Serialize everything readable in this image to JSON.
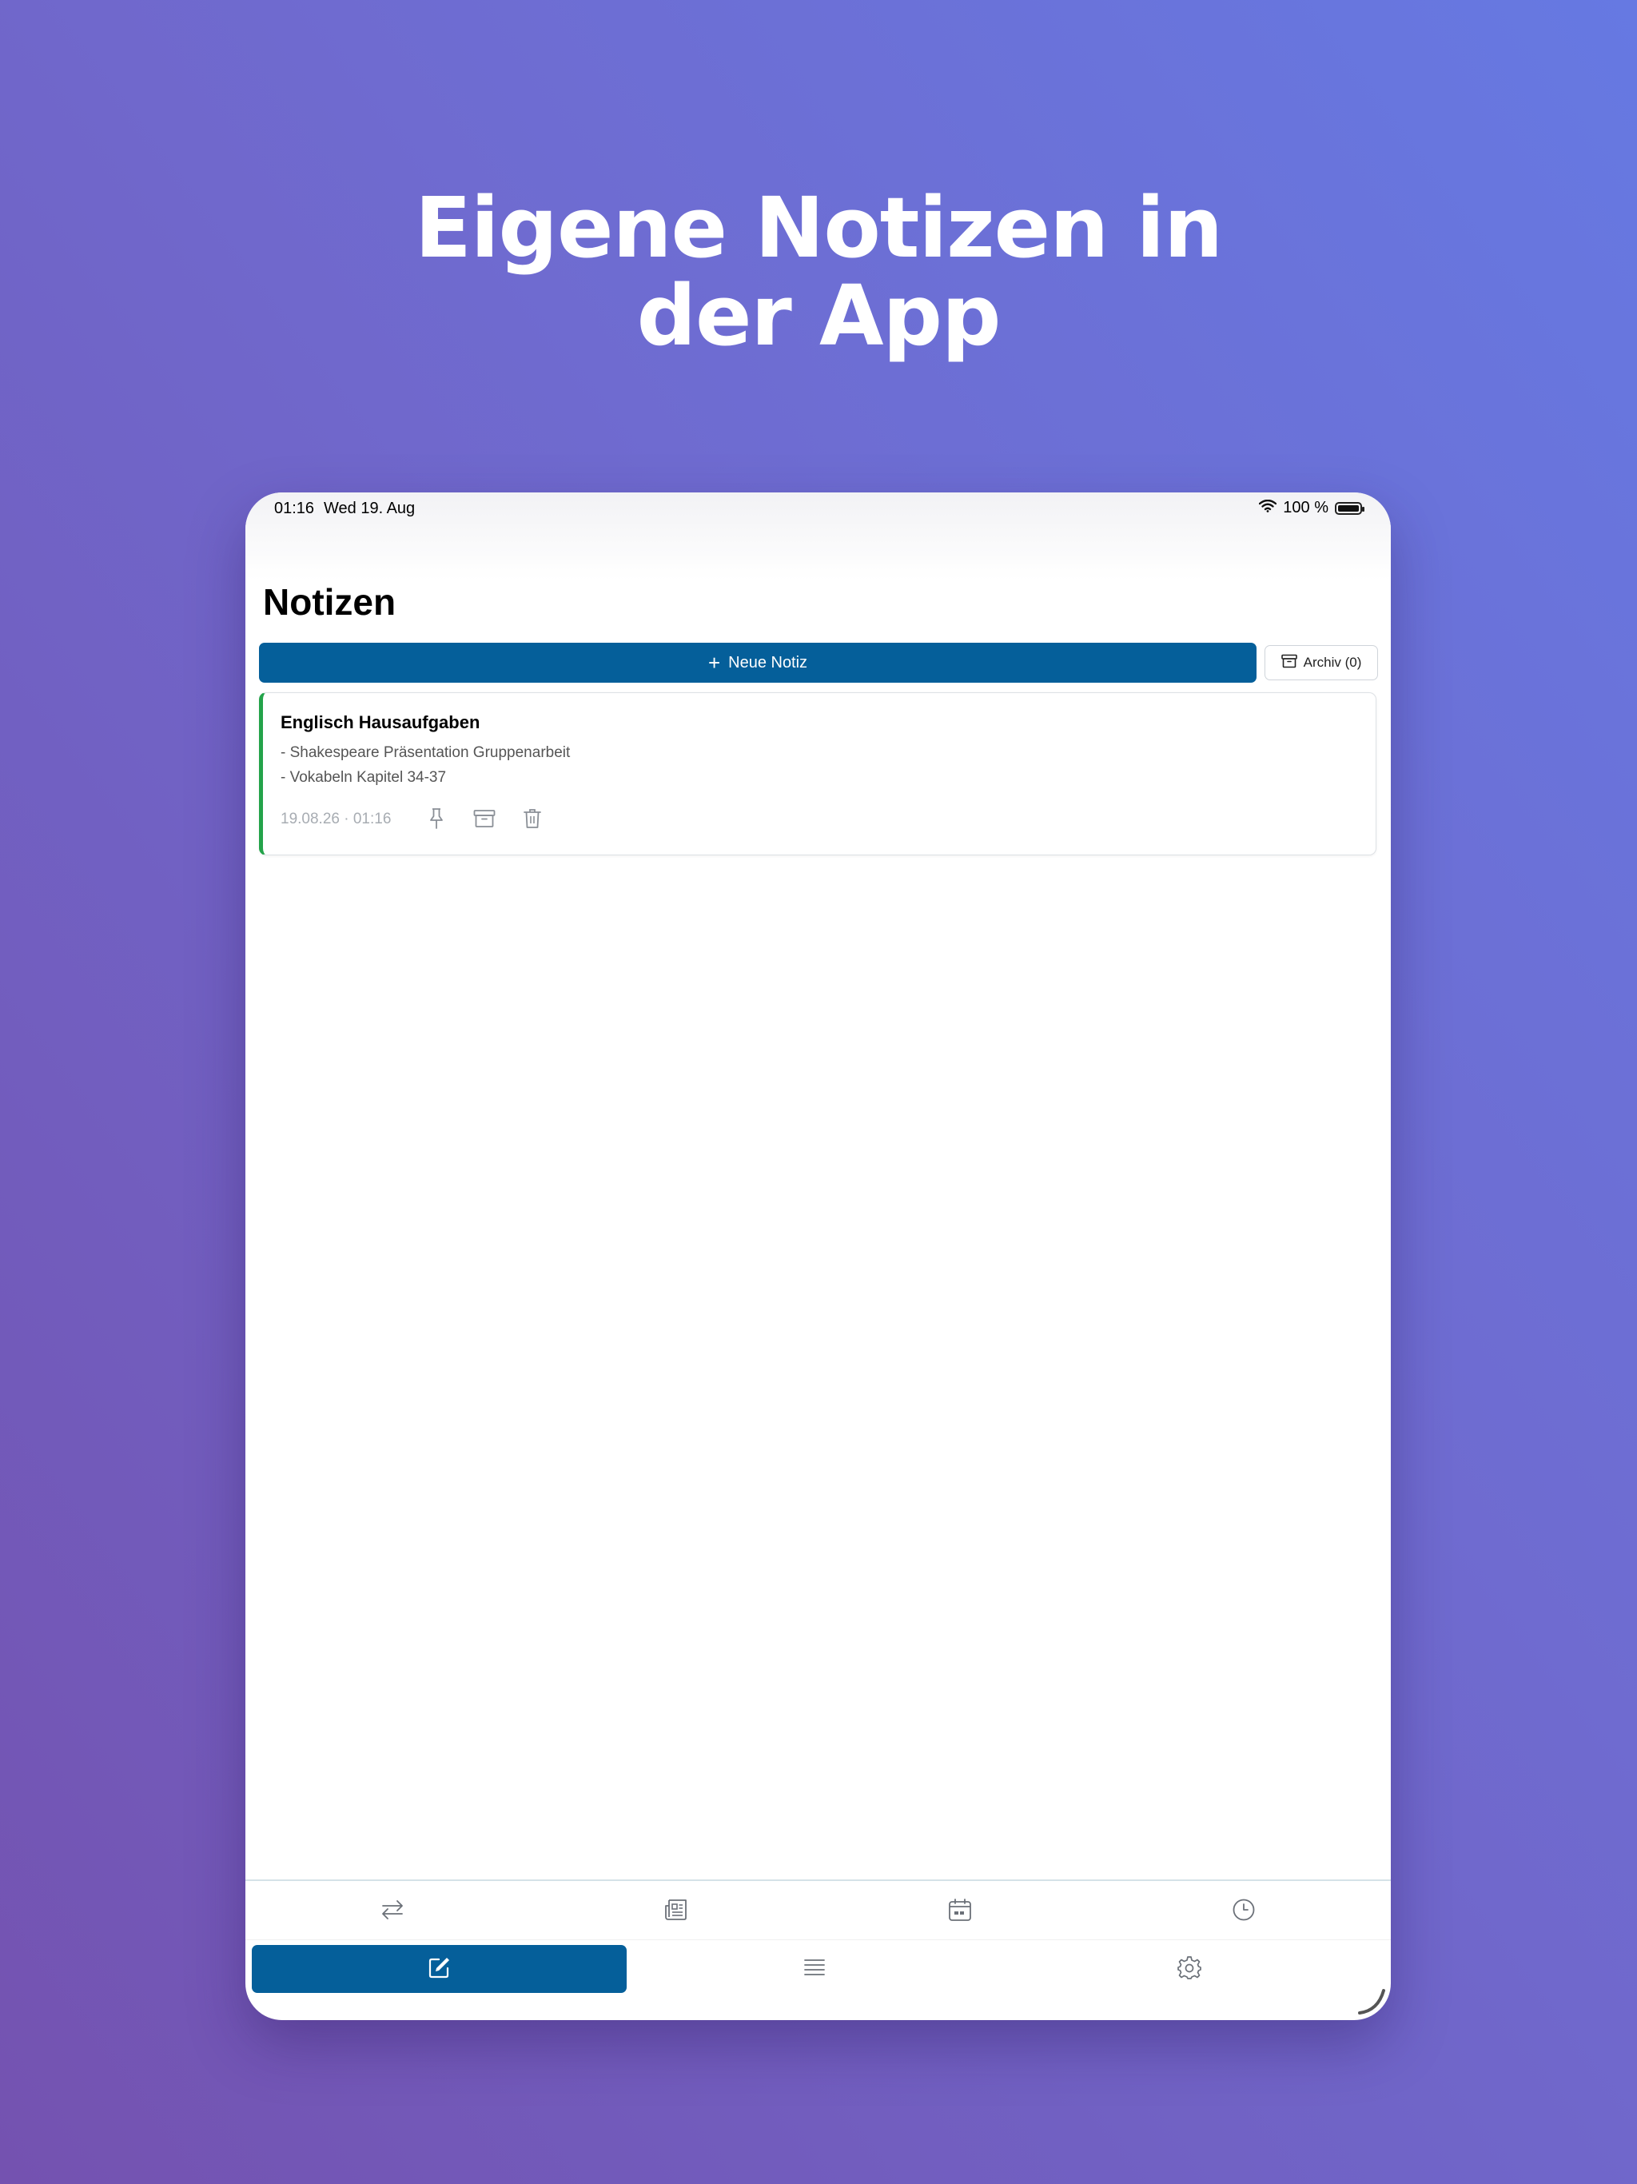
{
  "headline": {
    "line1": "Eigene Notizen in",
    "line2": "der App"
  },
  "status_bar": {
    "time": "01:16",
    "date": "Wed 19. Aug",
    "battery": "100 %"
  },
  "page": {
    "title": "Notizen"
  },
  "toolbar": {
    "new_note_label": "Neue Notiz",
    "archive_label": "Archiv (0)"
  },
  "notes": [
    {
      "title": "Englisch Hausaufgaben",
      "lines": [
        "- Shakespeare Präsentation Gruppenarbeit",
        "- Vokabeln Kapitel 34-37"
      ],
      "meta": "19.08.26 · 01:16",
      "accent": "#23a34a",
      "actions": [
        "pin-icon",
        "archive-icon",
        "trash-icon"
      ]
    }
  ],
  "tabs_row1": [
    "swap-icon",
    "news-icon",
    "calendar-icon",
    "clock-icon"
  ],
  "tabs_row2": [
    {
      "icon": "edit-icon",
      "active": true
    },
    {
      "icon": "list-icon",
      "active": false
    },
    {
      "icon": "gear-icon",
      "active": false
    }
  ],
  "colors": {
    "primary": "#055f9a",
    "accent_green": "#23a34a",
    "background_top": "#6679e2",
    "background_bottom": "#7452b0"
  }
}
